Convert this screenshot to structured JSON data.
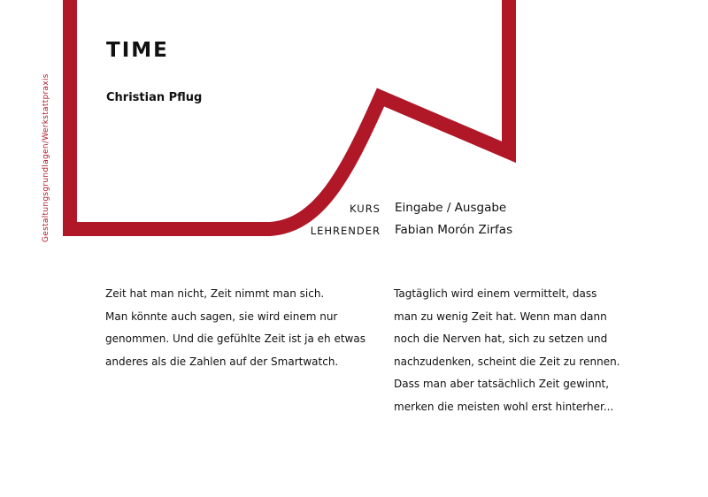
{
  "side_label": "Gestaltungsgrundlagen/Werkstattpraxis",
  "title": "TIME",
  "author": "Christian Pflug",
  "meta": {
    "course_label": "KURS",
    "course_value": "Eingabe / Ausgabe",
    "teacher_label": "LEHRENDER",
    "teacher_value": "Fabian Morón Zirfas"
  },
  "text_left": [
    "Zeit hat man nicht, Zeit nimmt man sich.",
    "Man könnte auch sagen, sie wird einem nur",
    "genommen. Und die gefühlte Zeit ist ja eh etwas",
    "anderes als die Zahlen auf der Smartwatch."
  ],
  "text_right": [
    "Tagtäglich wird einem vermittelt, dass",
    "man zu wenig Zeit hat. Wenn man dann",
    "noch die Nerven hat, sich zu setzen und",
    "nachzudenken, scheint die Zeit zu rennen.",
    "Dass man aber tatsächlich Zeit gewinnt,",
    "merken die meisten wohl erst hinterher..."
  ],
  "colors": {
    "accent": "#b01828",
    "text": "#111111",
    "background": "#ffffff"
  }
}
